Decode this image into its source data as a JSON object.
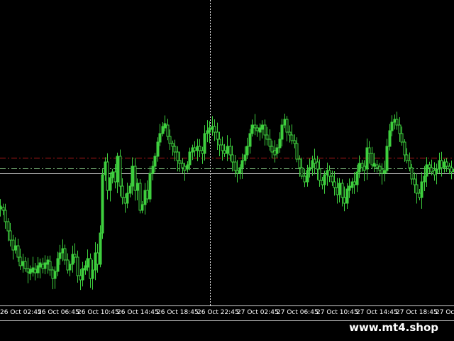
{
  "colors": {
    "background": "#000000",
    "candle": "#3ecf3e",
    "red_level": "#b01818",
    "green_level": "#7fbf7f",
    "white_level": "#c8c8c8",
    "crosshair": "#e8e8e8",
    "text": "#ffffff"
  },
  "chart_data": {
    "type": "candlestick",
    "style": "green-on-black",
    "price_scale_visible": false,
    "closes": [
      292,
      296,
      312,
      325,
      338,
      352,
      346,
      362,
      374,
      368,
      378,
      383,
      381,
      379,
      384,
      374,
      372,
      378,
      370,
      368,
      380,
      392,
      382,
      364,
      356,
      350,
      366,
      380,
      372,
      358,
      362,
      388,
      394,
      378,
      376,
      364,
      392,
      380,
      356,
      372,
      328,
      246,
      228,
      268,
      250,
      242,
      256,
      220,
      262,
      278,
      286,
      272,
      262,
      234,
      268,
      258,
      296,
      288,
      268,
      280,
      244,
      234,
      220,
      200,
      188,
      178,
      176,
      192,
      202,
      206,
      214,
      226,
      230,
      236,
      238,
      232,
      214,
      208,
      212,
      206,
      212,
      216,
      188,
      184,
      182,
      178,
      186,
      196,
      204,
      212,
      216,
      206,
      218,
      228,
      240,
      244,
      236,
      226,
      218,
      206,
      188,
      176,
      180,
      184,
      182,
      176,
      190,
      196,
      206,
      214,
      216,
      208,
      196,
      176,
      168,
      186,
      190,
      198,
      202,
      224,
      236,
      248,
      256,
      240,
      236,
      226,
      228,
      238,
      254,
      260,
      246,
      240,
      248,
      256,
      264,
      274,
      258,
      278,
      286,
      266,
      264,
      256,
      260,
      242,
      230,
      236,
      238,
      208,
      216,
      232,
      232,
      236,
      238,
      244,
      240,
      206,
      184,
      172,
      168,
      176,
      188,
      200,
      218,
      226,
      236,
      252,
      260,
      272,
      278,
      256,
      248,
      232,
      236,
      242,
      244,
      238,
      226,
      236,
      228,
      234,
      238,
      240,
      240
    ],
    "levels": {
      "red_dashdot": 222,
      "green_dashdot": 237,
      "white_solid": 244
    },
    "crosshair_x_label": "26 Oct 22:45"
  },
  "time_axis": {
    "labels": [
      "26 Oct 02:45",
      "26 Oct 06:45",
      "26 Oct 10:45",
      "26 Oct 14:45",
      "26 Oct 18:45",
      "26 Oct 22:45",
      "27 Oct 02:45",
      "27 Oct 06:45",
      "27 Oct 10:45",
      "27 Oct 14:45",
      "27 Oct 18:45",
      "27 Oct"
    ]
  },
  "watermark": {
    "text": "www.mt4.shop"
  }
}
